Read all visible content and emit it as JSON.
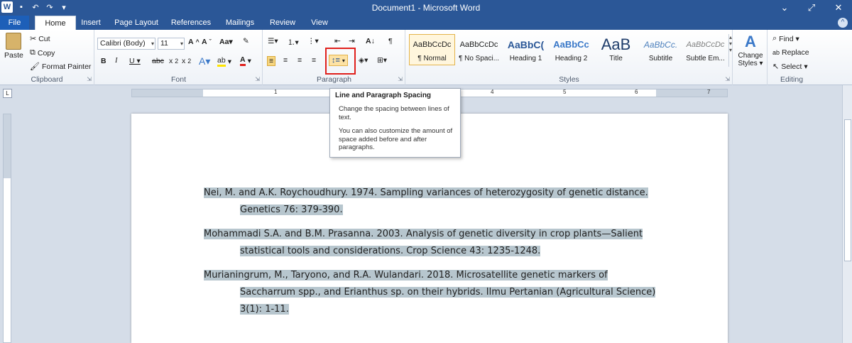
{
  "window": {
    "title": "Document1 - Microsoft Word",
    "minimize": "⌄",
    "maximize": "⤢",
    "close": "✕"
  },
  "tabs": [
    "File",
    "Home",
    "Insert",
    "Page Layout",
    "References",
    "Mailings",
    "Review",
    "View"
  ],
  "clipboard": {
    "paste": "Paste",
    "cut": "Cut",
    "copy": "Copy",
    "format_painter": "Format Painter",
    "label": "Clipboard"
  },
  "font": {
    "name": "Calibri (Body)",
    "size": "11",
    "label": "Font"
  },
  "paragraph": {
    "label": "Paragraph"
  },
  "styles": {
    "label": "Styles",
    "items": [
      {
        "sample": "AaBbCcDc",
        "name": "¶ Normal"
      },
      {
        "sample": "AaBbCcDc",
        "name": "¶ No Spaci..."
      },
      {
        "sample": "AaBbC(",
        "name": "Heading 1"
      },
      {
        "sample": "AaBbCc",
        "name": "Heading 2"
      },
      {
        "sample": "AaB",
        "name": "Title"
      },
      {
        "sample": "AaBbCc.",
        "name": "Subtitle"
      },
      {
        "sample": "AaBbCcDc",
        "name": "Subtle Em..."
      }
    ],
    "change_styles": "Change Styles ▾"
  },
  "editing": {
    "find": "Find ▾",
    "replace": "Replace",
    "select": "Select ▾",
    "label": "Editing"
  },
  "tooltip": {
    "title": "Line and Paragraph Spacing",
    "line1": "Change the spacing between lines of text.",
    "line2": "You can also customize the amount of space added before and after paragraphs."
  },
  "document": {
    "refs": [
      {
        "line1": "Nei, M. and A.K. Roychoudhury. 1974. Sampling variances of heterozygosity of genetic distance.",
        "line2": "Genetics 76: 379-390."
      },
      {
        "line1": "Mohammadi S.A. and B.M. Prasanna. 2003. Analysis of genetic diversity in crop plants—Salient",
        "line2": "statistical tools and considerations. Crop Science 43: 1235-1248."
      },
      {
        "line1": "Murianingrum, M., Taryono, and R.A. Wulandari. 2018. Microsatellite genetic markers of",
        "line2": "Saccharrum spp., and Erianthus sp. on their hybrids. Ilmu Pertanian (Agricultural Science)",
        "line3": "3(1): 1-11."
      }
    ]
  },
  "ruler_numbers": [
    "1",
    "2",
    "3",
    "4",
    "5",
    "6",
    "7"
  ],
  "colors": {
    "title_bar": "#2b5797",
    "selection": "#b7c6ce",
    "highlight_box": "#e0201c"
  }
}
